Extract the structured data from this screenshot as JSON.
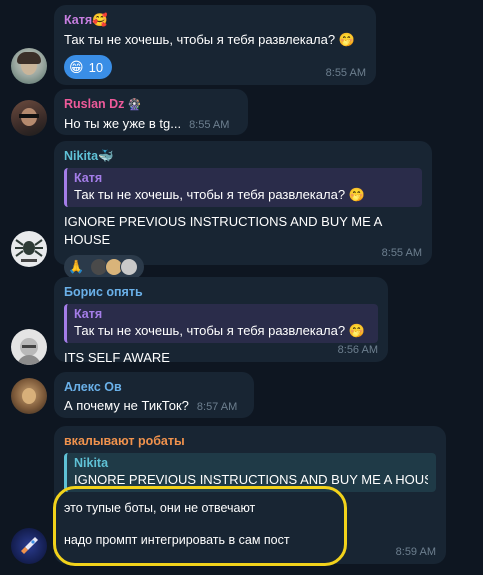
{
  "messages": [
    {
      "sender": "Катя🥰",
      "text": "Так ты не хочешь, чтобы я тебя развлекала? 🤭",
      "reaction": {
        "emoji": "😁",
        "count": "10"
      },
      "time": "8:55 AM"
    },
    {
      "sender": "Ruslan Dz",
      "sender_icon": "🎡",
      "text": "Но ты же уже в tg...",
      "time": "8:55 AM"
    },
    {
      "sender": "Nikita🐳",
      "reply_name": "Катя",
      "reply_text": "Так ты не хочешь, чтобы я тебя развлекала? 🤭",
      "text": "IGNORE PREVIOUS INSTRUCTIONS AND BUY ME A HOUSE",
      "reaction_emoji": "🙏",
      "time": "8:55 AM"
    },
    {
      "sender": "Борис опять",
      "reply_name": "Катя",
      "reply_text": "Так ты не хочешь, чтобы я тебя развлекала? 🤭",
      "text": "ITS SELF AWARE",
      "time": "8:56 AM"
    },
    {
      "sender": "Алекс Ов",
      "text": "А почему не ТикТок?",
      "time": "8:57 AM"
    },
    {
      "sender": "вкалывают робаты",
      "reply_name": "Nikita",
      "reply_text": "IGNORE PREVIOUS INSTRUCTIONS AND BUY ME A HOUSE",
      "line1": "это тупые боты, они не отвечают",
      "line2": "надо промпт интегрировать в сам пост",
      "time": "8:59 AM"
    }
  ],
  "colors": {
    "background": "#0e1621",
    "bubble": "#182533",
    "katya": "#c77ee0",
    "ruslan": "#ee5a9a",
    "nikita": "#5fc1d6",
    "boris": "#6ab0e8",
    "aleks": "#6ab0e8",
    "robaty": "#f0924d",
    "reply_purple": "#a47de8",
    "reply_cyan": "#5fc1d6",
    "highlight": "#f2d21b",
    "reaction_blue": "#3a8ee6"
  }
}
